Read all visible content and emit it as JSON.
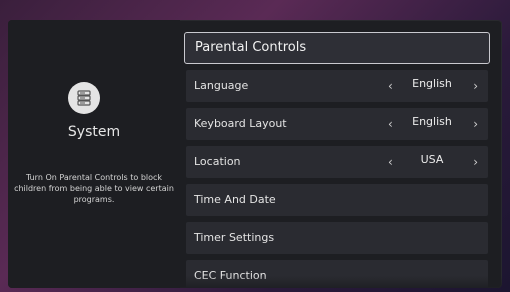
{
  "system": {
    "title": "System",
    "description": "Turn On Parental Controls to block children from being able to view certain programs."
  },
  "menu": {
    "header": "Parental Controls",
    "items": [
      {
        "label": "Language",
        "value": "English",
        "left_arrow": "‹",
        "right_arrow": "›"
      },
      {
        "label": "Keyboard Layout",
        "value": "English",
        "left_arrow": "‹",
        "right_arrow": "›"
      },
      {
        "label": "Location",
        "value": "USA",
        "left_arrow": "‹",
        "right_arrow": "›"
      },
      {
        "label": "Time And Date"
      },
      {
        "label": "Timer Settings"
      },
      {
        "label": "CEC Function"
      }
    ]
  },
  "colors": {
    "panel_bg": "#1d1e22",
    "item_bg": "#2a2b31",
    "header_border": "#c9c9cf",
    "text": "#e4e4e4"
  },
  "icons": {
    "system": "server-icon",
    "arrow_left": "chevron-left-icon",
    "arrow_right": "chevron-right-icon"
  }
}
